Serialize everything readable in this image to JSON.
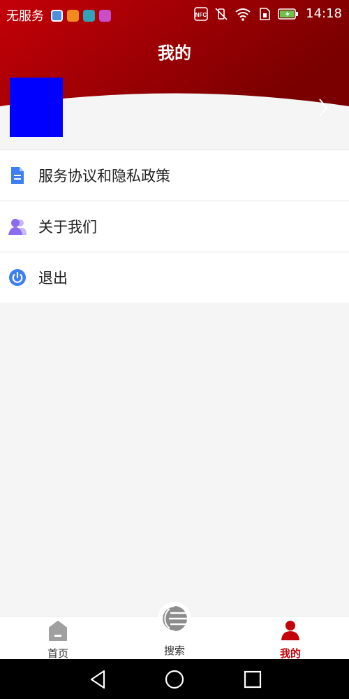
{
  "status_bar": {
    "carrier": "无服务",
    "app_icons": [
      {
        "name": "chat-app-icon",
        "color": "#4a8fe0"
      },
      {
        "name": "heart-app-icon",
        "color": "#f08c1e"
      },
      {
        "name": "cs-app-icon",
        "color": "#2fa3b8"
      },
      {
        "name": "pink-app-icon",
        "color": "#c84fc8"
      }
    ],
    "nfc": "NFC",
    "time": "14:18"
  },
  "header": {
    "title": "我的",
    "gradient_start": "#c40008",
    "gradient_end": "#7a0000"
  },
  "profile": {
    "avatar_color": "#0000ff"
  },
  "menu": {
    "items": [
      {
        "label": "服务协议和隐私政策",
        "icon": "document-icon",
        "icon_color": "#3d7ff0"
      },
      {
        "label": "关于我们",
        "icon": "users-icon",
        "icon_color": "#8b6cf0"
      },
      {
        "label": "退出",
        "icon": "power-icon",
        "icon_color": "#3d7ff0"
      }
    ]
  },
  "tabs": {
    "home": "首页",
    "search": "搜索",
    "mine": "我的",
    "active_color": "#c40008",
    "inactive_color": "#999999"
  }
}
